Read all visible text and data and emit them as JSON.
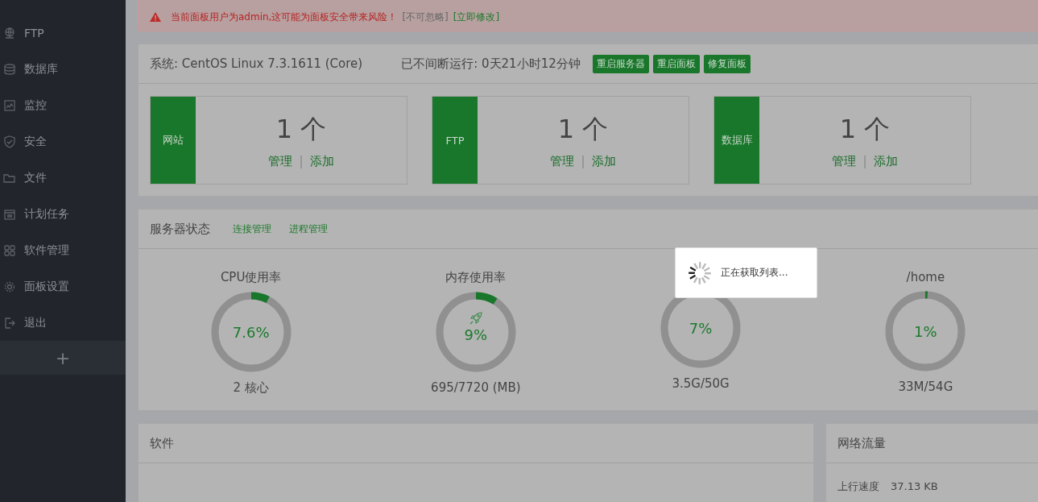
{
  "sidebar": {
    "items": [
      {
        "kind": "ftp",
        "label": "FTP"
      },
      {
        "kind": "database",
        "label": "数据库"
      },
      {
        "kind": "monitor",
        "label": "监控"
      },
      {
        "kind": "security",
        "label": "安全"
      },
      {
        "kind": "files",
        "label": "文件"
      },
      {
        "kind": "cron",
        "label": "计划任务"
      },
      {
        "kind": "software",
        "label": "软件管理"
      },
      {
        "kind": "settings",
        "label": "面板设置"
      },
      {
        "kind": "logout",
        "label": "退出"
      }
    ],
    "add_button": "+"
  },
  "alerts": [
    {
      "kind": "warning",
      "text": "当前面板用户为admin,这可能为面板安全带来风险！",
      "note": "[不可忽略]",
      "link": "[立即修改]"
    }
  ],
  "system": {
    "os": "系统: CentOS Linux 7.3.1611 (Core)",
    "uptime": "已不间断运行: 0天21小时12分钟",
    "buttons": [
      "重启服务器",
      "重启面板",
      "修复面板"
    ]
  },
  "stats": [
    {
      "label": "网站",
      "count": "1 个",
      "manage": "管理",
      "separator": "|",
      "add": "添加"
    },
    {
      "label": "FTP",
      "count": "1 个",
      "manage": "管理",
      "separator": "|",
      "add": "添加"
    },
    {
      "label": "数据库",
      "count": "1 个",
      "manage": "管理",
      "separator": "|",
      "add": "添加"
    }
  ],
  "server_status": {
    "title": "服务器状态",
    "links": [
      "连接管理",
      "进程管理"
    ],
    "gauges": [
      {
        "kind": "cpu",
        "title": "CPU使用率",
        "value": "7.6%",
        "level": 0.076,
        "detail": "2 核心"
      },
      {
        "kind": "memory",
        "title": "内存使用率",
        "value": "9%",
        "level": 0.09,
        "detail": "695/7720 (MB)"
      },
      {
        "kind": "disk",
        "value": "7%",
        "level": 0.07,
        "detail": "3.5G/50G"
      },
      {
        "kind": "disk",
        "title": "/home",
        "value": "1%",
        "level": 0.01,
        "detail": "33M/54G"
      }
    ]
  },
  "software": {
    "title": "软件"
  },
  "network": {
    "title": "网络流量",
    "rows": [
      {
        "label": "上行速度",
        "value": "37.13 KB"
      }
    ]
  },
  "loading": {
    "text": "正在获取列表..."
  }
}
